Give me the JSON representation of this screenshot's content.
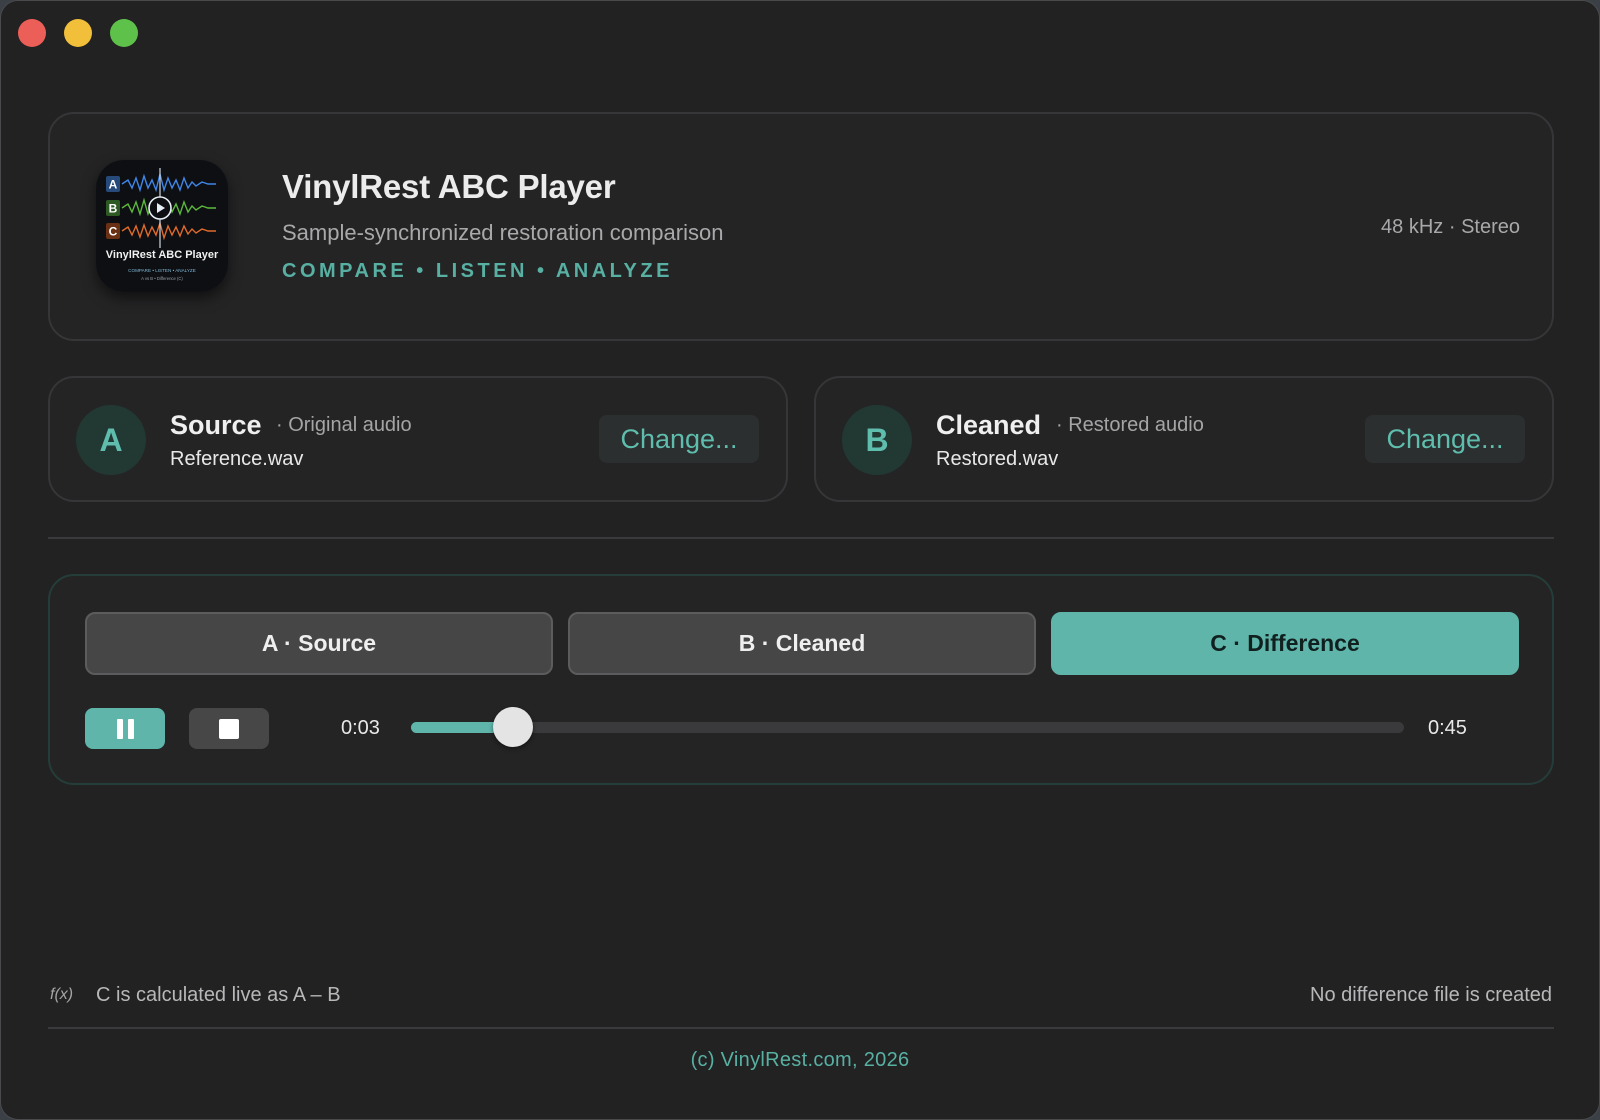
{
  "window": {
    "controls": [
      "close",
      "minimize",
      "maximize"
    ]
  },
  "header": {
    "app_title": "VinylRest ABC Player",
    "subtitle": "Sample-synchronized restoration comparison",
    "tagline": "COMPARE • LISTEN • ANALYZE",
    "format": "48 kHz · Stereo",
    "icon": {
      "rows": [
        "A",
        "B",
        "C"
      ],
      "wordmark": "VinylRest ABC Player",
      "small_text_1": "COMPARE • LISTEN • ANALYZE",
      "small_text_2": "A vs B • Difference (C)"
    }
  },
  "source": {
    "badge": "A",
    "title": "Source",
    "description": "· Original audio",
    "filename": "Reference.wav",
    "change_label": "Change..."
  },
  "cleaned": {
    "badge": "B",
    "title": "Cleaned",
    "description": "· Restored audio",
    "filename": "Restored.wav",
    "change_label": "Change..."
  },
  "player": {
    "segments": [
      {
        "label": "A · Source",
        "selected": false
      },
      {
        "label": "B · Cleaned",
        "selected": false
      },
      {
        "label": "C · Difference",
        "selected": true
      }
    ],
    "current_time": "0:03",
    "total_time": "0:45",
    "progress": 0.103
  },
  "footer": {
    "fx_icon": "f(x)",
    "formula": "C is calculated live as A – B",
    "note": "No difference file is created",
    "copyright": "(c) VinylRest.com, 2026"
  },
  "colors": {
    "accent": "#5fb5aa",
    "wave_a": "#3f86e8",
    "wave_b": "#5cb83c",
    "wave_c": "#e06a2c"
  }
}
